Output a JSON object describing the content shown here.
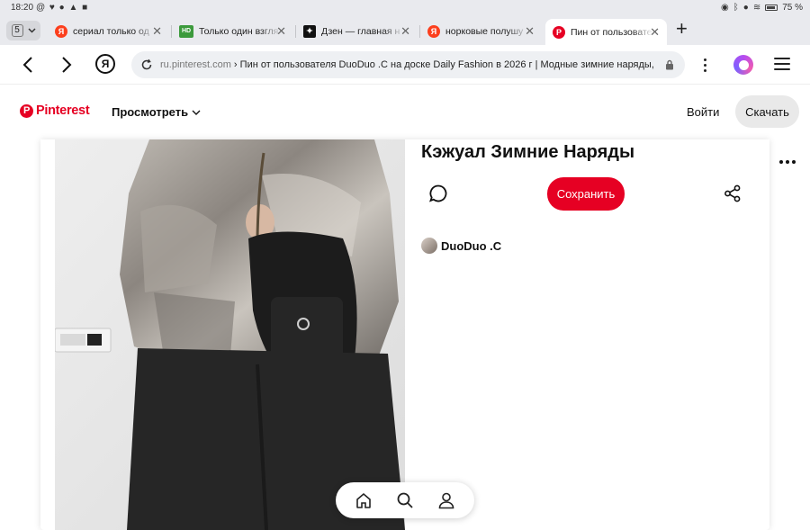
{
  "status_bar": {
    "time": "18:20",
    "battery": "75 %"
  },
  "tabs": {
    "count": "5",
    "items": [
      {
        "title": "сериал только од",
        "favicon": "yandex-y",
        "color": "#fc3f1d"
      },
      {
        "title": "Только один взгля",
        "favicon": "hd-badge",
        "color": "#3c9a3c"
      },
      {
        "title": "Дзен — главная н",
        "favicon": "dzen-star",
        "color": "#111111"
      },
      {
        "title": "норковые полушу",
        "favicon": "yandex-y",
        "color": "#fc3f1d"
      },
      {
        "title": "Пин от пользовате",
        "favicon": "pinterest-p",
        "color": "#e60023"
      }
    ],
    "active_index": 4
  },
  "address": {
    "domain": "ru.pinterest.com",
    "separator": " › ",
    "page_title": "Пин от пользователя DuoDuo .C на доске Daily Fashion в 2026 г | Модные зимние наряды, Жен"
  },
  "pinterest": {
    "logo": "Pinterest",
    "explore": "Просмотреть",
    "login": "Войти",
    "signup": "Скачать"
  },
  "pin": {
    "title": "Кэжуал Зимние Наряды",
    "save": "Сохранить",
    "author": "DuoDuo .C",
    "image_alt": "Woman in grey fur jacket with black quilted bag and black wide trousers"
  },
  "colors": {
    "brand": "#e60023",
    "chrome_bg": "#e9eaee",
    "url_bg": "#eef0f3"
  }
}
